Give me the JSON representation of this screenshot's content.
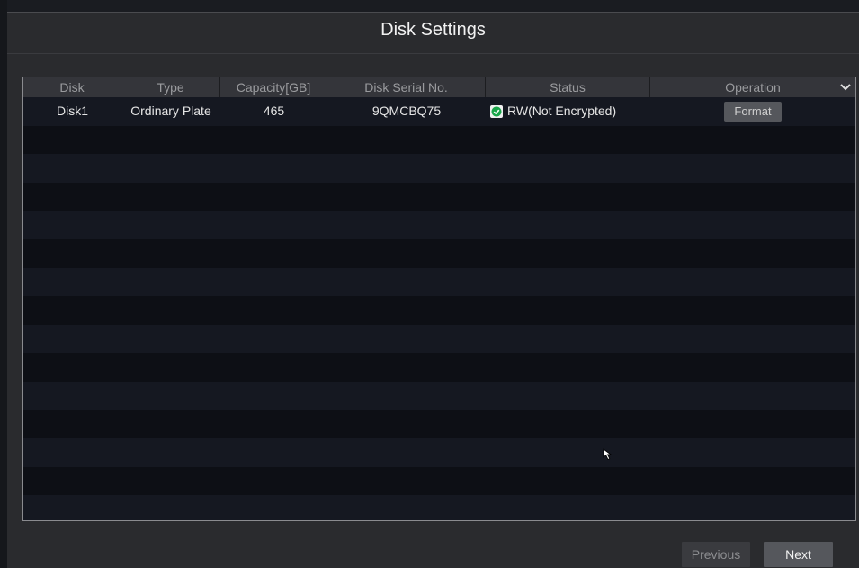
{
  "dialog": {
    "title": "Disk Settings"
  },
  "table": {
    "columns": [
      "Disk",
      "Type",
      "Capacity[GB]",
      "Disk Serial No.",
      "Status",
      "Operation"
    ],
    "rows": [
      {
        "disk": "Disk1",
        "type": "Ordinary Plate",
        "capacity": "465",
        "serial": "9QMCBQ75",
        "status": "RW(Not Encrypted)",
        "operation": "Format"
      }
    ]
  },
  "footer": {
    "previous_label": "Previous",
    "next_label": "Next"
  },
  "icons": {
    "status": "check-icon",
    "column_menu": "chevron-down-icon",
    "pointer": "mouse-cursor-icon"
  },
  "colors": {
    "status_ok": "#1aa64a"
  }
}
